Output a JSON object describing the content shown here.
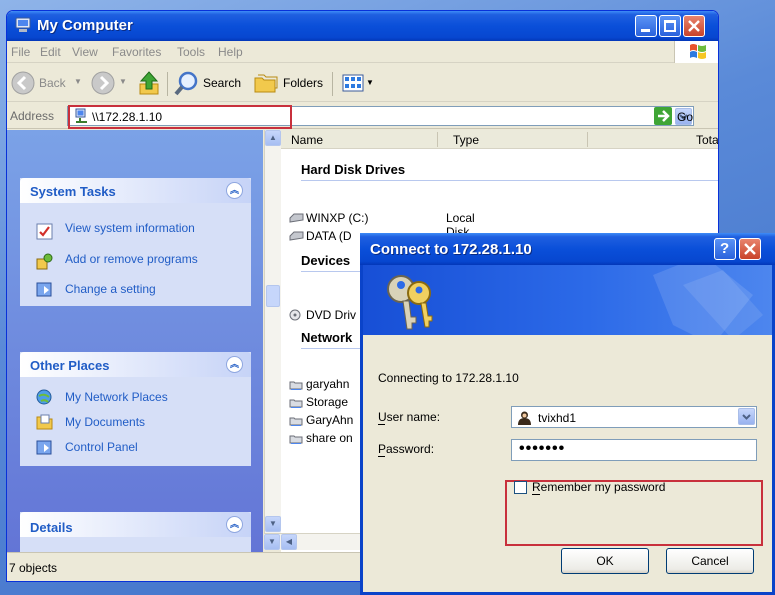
{
  "window": {
    "title": "My Computer",
    "menu": [
      "File",
      "Edit",
      "View",
      "Favorites",
      "Tools",
      "Help"
    ],
    "toolbar": {
      "back": "Back",
      "search": "Search",
      "folders": "Folders"
    },
    "address": {
      "label": "Address",
      "value": "\\\\172.28.1.10",
      "go": "Go"
    },
    "columns": [
      "Name",
      "Type",
      "Tota"
    ],
    "status": "7 objects"
  },
  "sidebar": {
    "system_tasks": {
      "title": "System Tasks",
      "items": [
        "View system information",
        "Add or remove programs",
        "Change a setting"
      ]
    },
    "other_places": {
      "title": "Other Places",
      "items": [
        "My Network Places",
        "My Documents",
        "Control Panel"
      ]
    },
    "details": {
      "title": "Details"
    }
  },
  "content": {
    "groups": {
      "hard_disks": "Hard Disk Drives",
      "devices": "Devices",
      "network": "Network"
    },
    "hard_disks": [
      "WINXP (C:)",
      "DATA (D"
    ],
    "hard_disk_type": "Local Disk",
    "devices": [
      "DVD Driv"
    ],
    "network": [
      "garyahn",
      "Storage",
      "GaryAhn",
      "share on"
    ]
  },
  "dialog": {
    "title": "Connect to 172.28.1.10",
    "connecting": "Connecting to 172.28.1.10",
    "username_label": "User name:",
    "username_value": "tvixhd1",
    "password_label": "Password:",
    "password_mask": "•••••••",
    "remember": "Remember my password",
    "ok": "OK",
    "cancel": "Cancel"
  },
  "colors": {
    "xp_blue": "#0a4fd9",
    "link_blue": "#215dc6",
    "highlight_red": "#c8303c",
    "chrome": "#ece9d8"
  }
}
